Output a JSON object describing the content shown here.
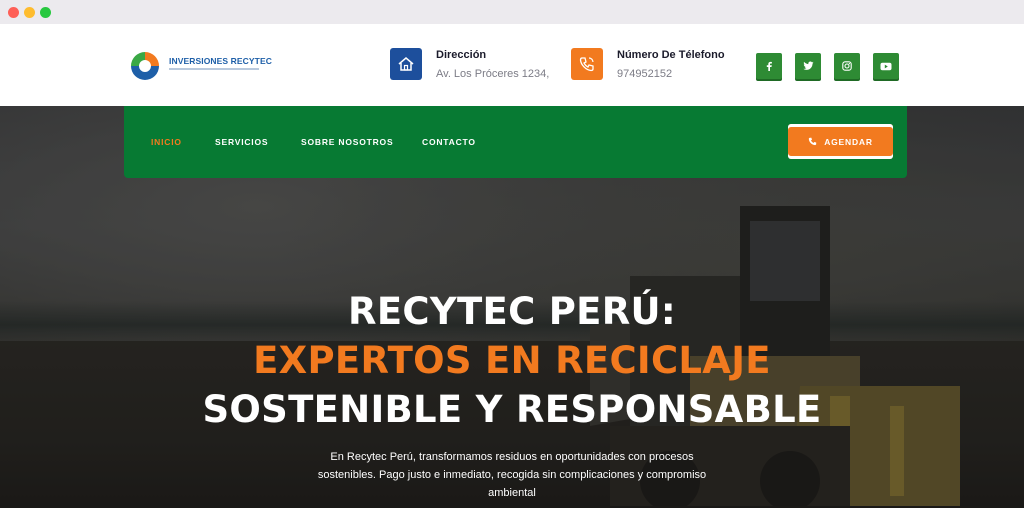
{
  "brand": {
    "name": "INVERSIONES RECYTEC"
  },
  "contact": {
    "address_title": "Dirección",
    "address_value": "Av. Los Próceres 1234,",
    "phone_title": "Número De Télefono",
    "phone_value": "974952152"
  },
  "social": [
    "facebook-icon",
    "twitter-icon",
    "instagram-icon",
    "youtube-icon"
  ],
  "nav": {
    "items": [
      {
        "label": "INICIO",
        "active": true
      },
      {
        "label": "SERVICIOS",
        "active": false
      },
      {
        "label": "SOBRE NOSOTROS",
        "active": false
      },
      {
        "label": "CONTACTO",
        "active": false
      }
    ],
    "cta_label": "AGENDAR"
  },
  "hero": {
    "line1": "RECYTEC PERÚ:",
    "line2": "EXPERTOS EN RECICLAJE",
    "line3": "SOSTENIBLE Y RESPONSABLE",
    "description": "En Recytec Perú, transformamos residuos en oportunidades con procesos sostenibles. Pago justo e inmediato, recogida sin complicaciones y compromiso ambiental"
  },
  "colors": {
    "green": "#077a33",
    "orange": "#f27a1f",
    "blue": "#1d4f9c"
  }
}
